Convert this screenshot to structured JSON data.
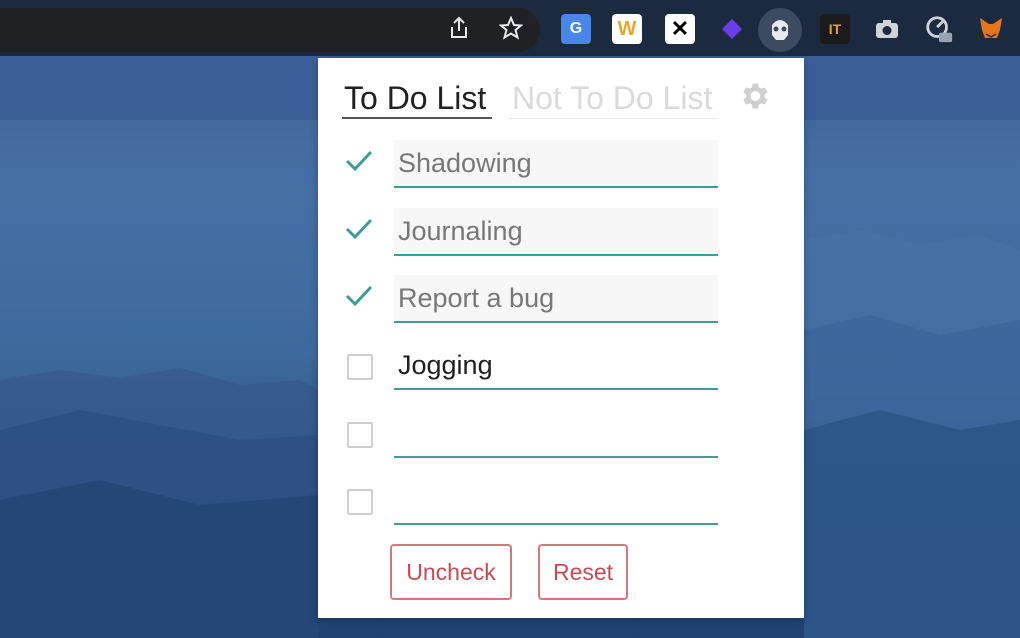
{
  "browser": {
    "toolbar_icons": [
      "share-icon",
      "bookmark-star-icon"
    ],
    "extensions": [
      {
        "name": "google-translate-icon",
        "color": "#4a86e8"
      },
      {
        "name": "w-extension-icon",
        "color": "#f2b84b",
        "glyph": "W"
      },
      {
        "name": "x-extension-icon",
        "color": "#ffffff",
        "glyph": "✕"
      },
      {
        "name": "purple-gem-icon",
        "color": "#6a3de8"
      },
      {
        "name": "stormtrooper-icon",
        "color": "#e8eaed"
      },
      {
        "name": "it-extension-icon",
        "color": "#e0a040",
        "glyph": "IT"
      },
      {
        "name": "camera-icon",
        "color": "#cfd3da"
      },
      {
        "name": "gauge-icon",
        "color": "#cfd3da"
      },
      {
        "name": "metamask-fox-icon",
        "color": "#e2761b"
      }
    ]
  },
  "popup": {
    "tabs": {
      "active": "To Do List",
      "inactive": "Not To Do List"
    },
    "accent_color": "#3f9c96",
    "danger_color": "#c94a55",
    "items": [
      {
        "text": "Shadowing",
        "checked": true
      },
      {
        "text": "Journaling",
        "checked": true
      },
      {
        "text": "Report a bug",
        "checked": true
      },
      {
        "text": "Jogging",
        "checked": false
      },
      {
        "text": "",
        "checked": false
      },
      {
        "text": "",
        "checked": false
      }
    ],
    "buttons": {
      "uncheck": "Uncheck",
      "reset": "Reset"
    }
  }
}
